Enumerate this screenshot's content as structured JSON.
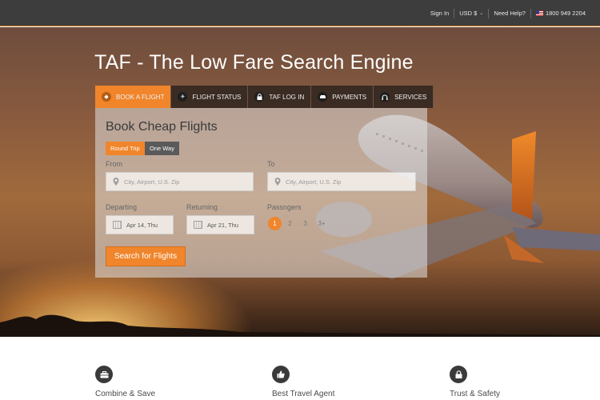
{
  "topnav": {
    "sign_in": "Sign In",
    "currency": "USD $",
    "help": "Need Help?",
    "phone": "1800 949 2204"
  },
  "hero": {
    "title": "TAF - The Low Fare Search Engine"
  },
  "tabs": [
    {
      "label": "BOOK A FLIGHT",
      "icon": "tag-icon",
      "active": true
    },
    {
      "label": "FLIGHT STATUS",
      "icon": "plane-icon",
      "active": false
    },
    {
      "label": "TAF LOG IN",
      "icon": "lock-icon",
      "active": false
    },
    {
      "label": "PAYMENTS",
      "icon": "car-icon",
      "active": false
    },
    {
      "label": "SERVICES",
      "icon": "headset-icon",
      "active": false
    }
  ],
  "search": {
    "title": "Book Cheap Flights",
    "round_trip": "Round Trip",
    "one_way": "One Way",
    "from_label": "From",
    "to_label": "To",
    "from_placeholder": "City, Airport, U.S. Zip",
    "to_placeholder": "City, Airport, U.S. Zip",
    "departing_label": "Departing",
    "returning_label": "Returning",
    "passengers_label": "Passngers",
    "departing_value": "Apr 14, Thu",
    "returning_value": "Apr 21, Thu",
    "passengers": [
      "1",
      "2",
      "3",
      "3+"
    ],
    "selected_passengers": "1",
    "button": "Search for Flights"
  },
  "features": [
    {
      "label": "Combine & Save",
      "icon": "briefcase-icon"
    },
    {
      "label": "Best Travel Agent",
      "icon": "thumbs-up-icon"
    },
    {
      "label": "Trust & Safety",
      "icon": "lock-icon"
    }
  ],
  "colors": {
    "accent": "#f0852b",
    "topbar": "#3d3d3d",
    "tab_bg": "#3a2b23"
  }
}
